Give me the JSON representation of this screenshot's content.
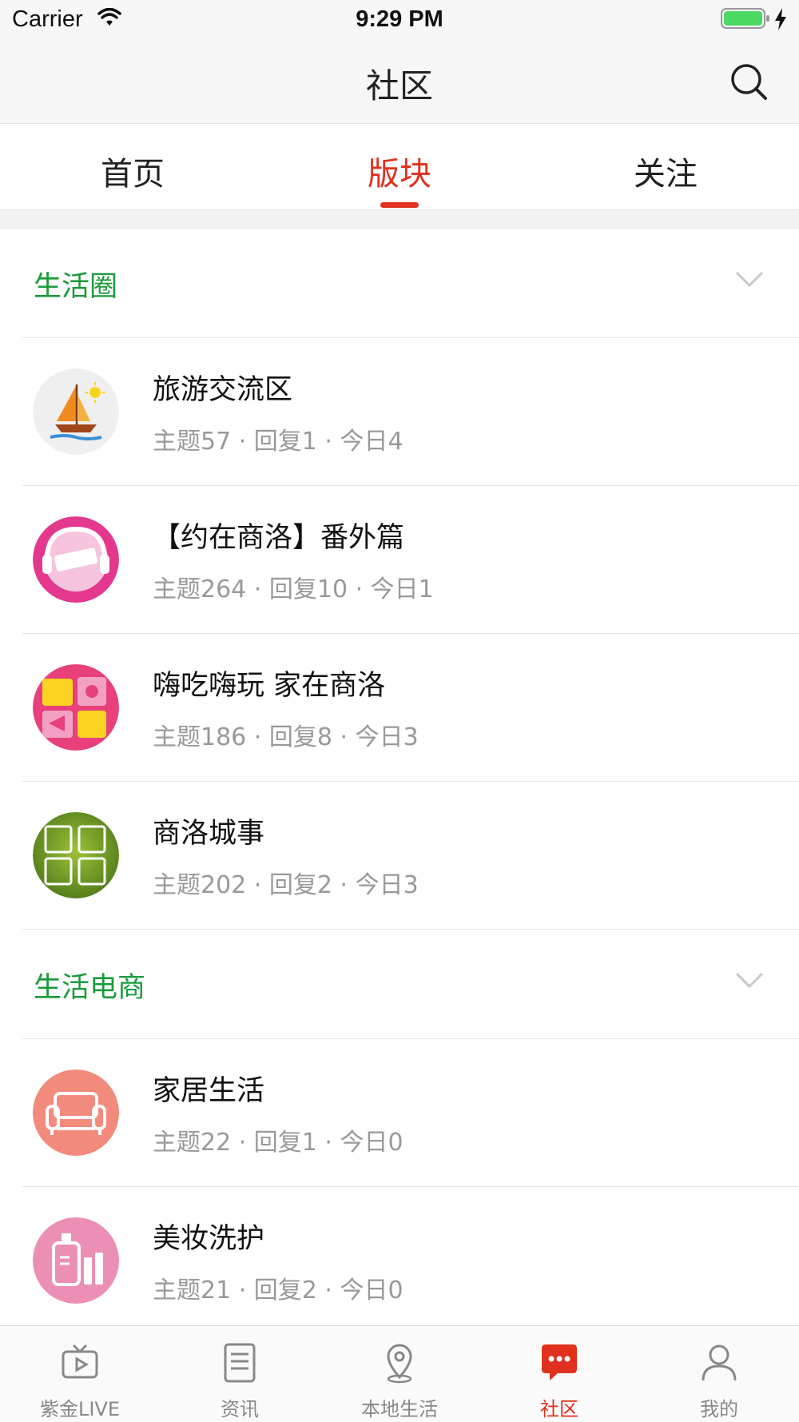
{
  "status_bar": {
    "carrier": "Carrier",
    "time": "9:29 PM",
    "battery_color": "#4cd964"
  },
  "nav": {
    "title": "社区",
    "search_icon": "search-icon"
  },
  "tabs": [
    {
      "label": "首页",
      "active": false
    },
    {
      "label": "版块",
      "active": true
    },
    {
      "label": "关注",
      "active": false
    }
  ],
  "accent_color": "#e0301e",
  "section_color": "#1a9a3a",
  "sections": [
    {
      "title": "生活圈",
      "items": [
        {
          "name": "旅游交流区",
          "stats": "主题57 · 回复1 · 今日4",
          "icon": "sailboat-icon"
        },
        {
          "name": "【约在商洛】番外篇",
          "stats": "主题264 · 回复10 · 今日1",
          "icon": "yue-zai-shangluo-logo"
        },
        {
          "name": "嗨吃嗨玩 家在商洛",
          "stats": "主题186 · 回复8 · 今日3",
          "icon": "chi-he-wan-le-logo"
        },
        {
          "name": "商洛城事",
          "stats": "主题202 · 回复2 · 今日3",
          "icon": "shangluo-chengshi-logo"
        }
      ]
    },
    {
      "title": "生活电商",
      "items": [
        {
          "name": "家居生活",
          "stats": "主题22 · 回复1 · 今日0",
          "icon": "sofa-icon"
        },
        {
          "name": "美妆洗护",
          "stats": "主题21 · 回复2 · 今日0",
          "icon": "cosmetics-icon"
        }
      ]
    }
  ],
  "tabbar": [
    {
      "label": "紫金LIVE",
      "icon": "tv-icon",
      "active": false
    },
    {
      "label": "资讯",
      "icon": "news-icon",
      "active": false
    },
    {
      "label": "本地生活",
      "icon": "location-pin-icon",
      "active": false
    },
    {
      "label": "社区",
      "icon": "chat-bubble-icon",
      "active": true
    },
    {
      "label": "我的",
      "icon": "user-icon",
      "active": false
    }
  ]
}
